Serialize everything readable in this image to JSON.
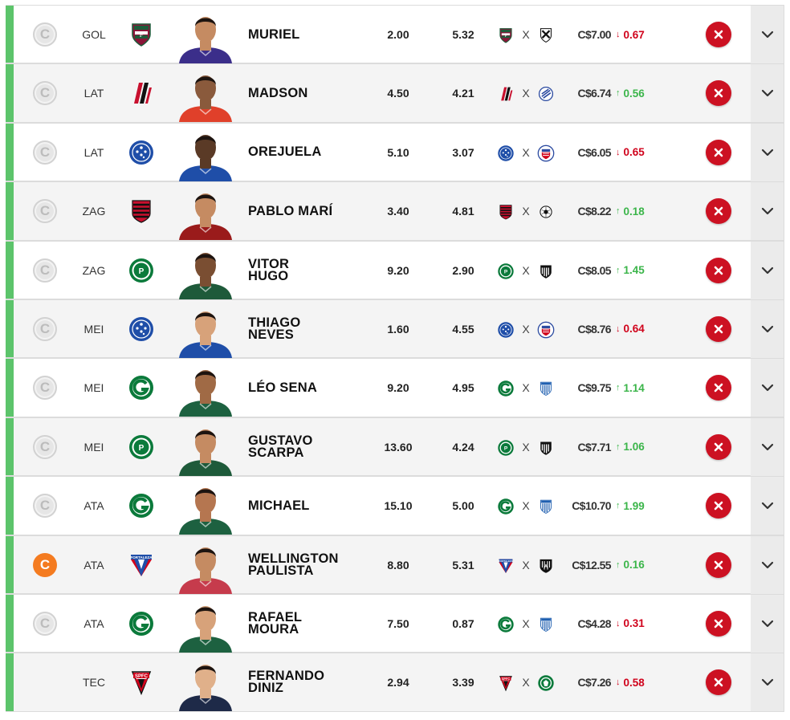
{
  "colors": {
    "accent_green": "#5cc46b",
    "remove_red": "#cc1122",
    "up_green": "#3bb54a",
    "down_red": "#d0021b",
    "captain_active": "#f47b20"
  },
  "players": [
    {
      "position": "GOL",
      "name": [
        "MURIEL"
      ],
      "last_points": "2.00",
      "average": "5.32",
      "team": "fluminense",
      "opponent": "vasco",
      "price": "C$7.00",
      "variation": "0.67",
      "trend": "down",
      "captain": false,
      "accent": true
    },
    {
      "position": "LAT",
      "name": [
        "MADSON"
      ],
      "last_points": "4.50",
      "average": "4.21",
      "team": "athletico",
      "opponent": "bahia-hawk",
      "price": "C$6.74",
      "variation": "0.56",
      "trend": "up",
      "captain": false,
      "accent": true
    },
    {
      "position": "LAT",
      "name": [
        "OREJUELA"
      ],
      "last_points": "5.10",
      "average": "3.07",
      "team": "cruzeiro",
      "opponent": "bahia",
      "price": "C$6.05",
      "variation": "0.65",
      "trend": "down",
      "captain": false,
      "accent": true
    },
    {
      "position": "ZAG",
      "name": [
        "PABLO MARÍ"
      ],
      "last_points": "3.40",
      "average": "4.81",
      "team": "flamengo",
      "opponent": "corinthians",
      "price": "C$8.22",
      "variation": "0.18",
      "trend": "up",
      "captain": false,
      "accent": true
    },
    {
      "position": "ZAG",
      "name": [
        "VITOR",
        "HUGO"
      ],
      "last_points": "9.20",
      "average": "2.90",
      "team": "palmeiras",
      "opponent": "ceara",
      "price": "C$8.05",
      "variation": "1.45",
      "trend": "up",
      "captain": false,
      "accent": true
    },
    {
      "position": "MEI",
      "name": [
        "THIAGO",
        "NEVES"
      ],
      "last_points": "1.60",
      "average": "4.55",
      "team": "cruzeiro",
      "opponent": "bahia",
      "price": "C$8.76",
      "variation": "0.64",
      "trend": "down",
      "captain": false,
      "accent": true
    },
    {
      "position": "MEI",
      "name": [
        "LÉO SENA"
      ],
      "last_points": "9.20",
      "average": "4.95",
      "team": "goias",
      "opponent": "avai",
      "price": "C$9.75",
      "variation": "1.14",
      "trend": "up",
      "captain": false,
      "accent": true
    },
    {
      "position": "MEI",
      "name": [
        "GUSTAVO",
        "SCARPA"
      ],
      "last_points": "13.60",
      "average": "4.24",
      "team": "palmeiras",
      "opponent": "ceara",
      "price": "C$7.71",
      "variation": "1.06",
      "trend": "up",
      "captain": false,
      "accent": true
    },
    {
      "position": "ATA",
      "name": [
        "MICHAEL"
      ],
      "last_points": "15.10",
      "average": "5.00",
      "team": "goias",
      "opponent": "avai",
      "price": "C$10.70",
      "variation": "1.99",
      "trend": "up",
      "captain": false,
      "accent": true
    },
    {
      "position": "ATA",
      "name": [
        "WELLINGTON",
        "PAULISTA"
      ],
      "last_points": "8.80",
      "average": "5.31",
      "team": "fortaleza",
      "opponent": "atletico-mg",
      "price": "C$12.55",
      "variation": "0.16",
      "trend": "up",
      "captain": true,
      "accent": true
    },
    {
      "position": "ATA",
      "name": [
        "RAFAEL",
        "MOURA"
      ],
      "last_points": "7.50",
      "average": "0.87",
      "team": "goias",
      "opponent": "avai",
      "price": "C$4.28",
      "variation": "0.31",
      "trend": "down",
      "captain": false,
      "accent": true
    },
    {
      "position": "TEC",
      "name": [
        "FERNANDO",
        "DINIZ"
      ],
      "last_points": "2.94",
      "average": "3.39",
      "team": "sao-paulo",
      "opponent": "chapecoense",
      "price": "C$7.26",
      "variation": "0.58",
      "trend": "down",
      "captain": null,
      "accent": true
    }
  ],
  "labels": {
    "captain_letter": "C",
    "versus": "X",
    "crest_text": {
      "flamengo": "",
      "sao-paulo": "SPFC",
      "fortaleza": "FORTALEZA"
    }
  }
}
